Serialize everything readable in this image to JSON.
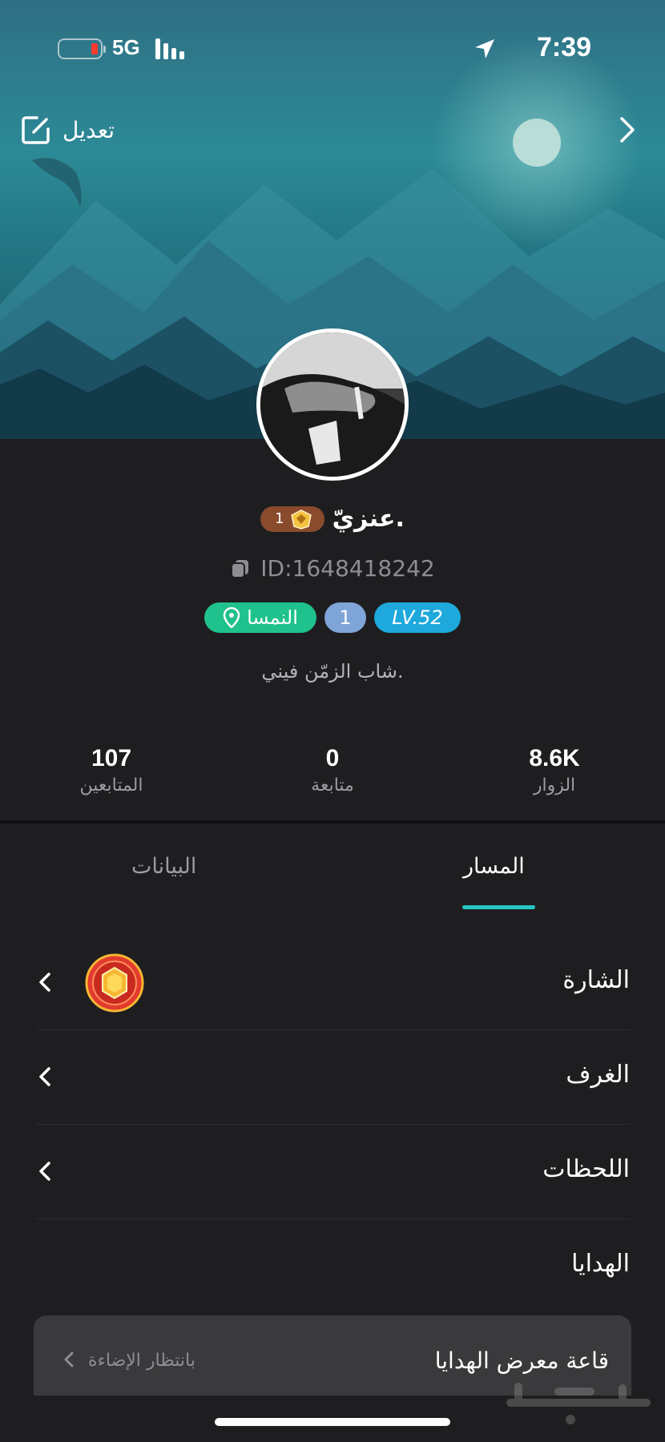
{
  "status_bar": {
    "time": "7:39",
    "network": "5G"
  },
  "header": {
    "edit_label": "تعديل"
  },
  "profile": {
    "username": "عنزيّ.",
    "rank_number": "1",
    "id_text": "ID:1648418242",
    "tags": {
      "location": "النمسا",
      "number": "1",
      "level": "LV.52"
    },
    "bio": "شاب الزمّن فيني."
  },
  "stats": {
    "visitors": {
      "value": "8.6K",
      "label": "الزوار"
    },
    "following": {
      "value": "0",
      "label": "متابعة"
    },
    "followers": {
      "value": "107",
      "label": "المتابعين"
    }
  },
  "tabs": [
    {
      "label": "المسار",
      "active": true
    },
    {
      "label": "البيانات",
      "active": false
    }
  ],
  "sections": [
    {
      "label": "الشارة"
    },
    {
      "label": "الغرف"
    },
    {
      "label": "اللحظات"
    },
    {
      "label": "الهدايا"
    }
  ],
  "gift_gallery": {
    "title": "قاعة معرض الهدايا",
    "status": "بانتظار الإضاءة"
  },
  "colors": {
    "accent": "#25c6c3",
    "location_tag": "#1fc18c",
    "level_tag": "#1ea8dc",
    "rank_badge": "#8a4a2c"
  }
}
